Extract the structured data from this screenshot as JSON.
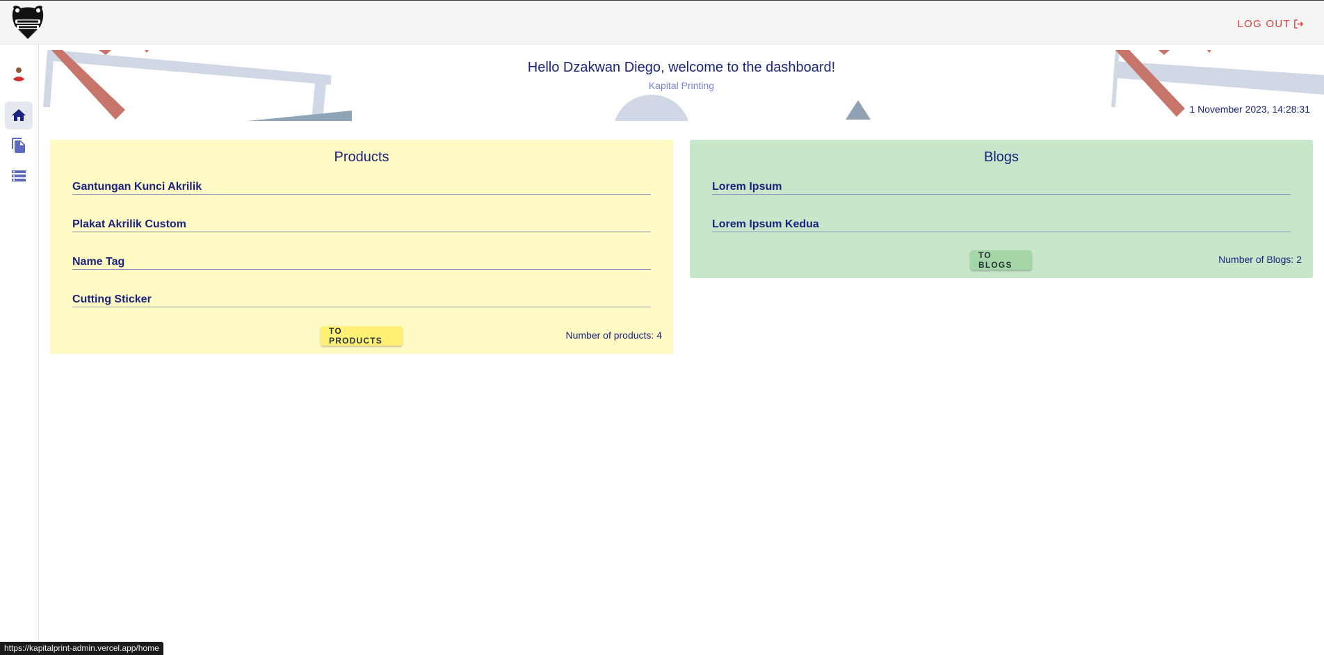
{
  "header": {
    "logout_label": "LOG OUT"
  },
  "hero": {
    "greeting": "Hello Dzakwan Diego, welcome to the dashboard!",
    "subtitle": "Kapital Printing",
    "datetime": "1 November 2023, 14:28:31"
  },
  "products": {
    "title": "Products",
    "items": [
      "Gantungan Kunci Akrilik",
      "Plakat Akrilik Custom",
      "Name Tag",
      "Cutting Sticker"
    ],
    "button_label": "TO PRODUCTS",
    "count_label": "Number of products: 4"
  },
  "blogs": {
    "title": "Blogs",
    "items": [
      "Lorem Ipsum",
      "Lorem Ipsum Kedua"
    ],
    "button_label": "TO BLOGS",
    "count_label": "Number of Blogs: 2"
  },
  "status_bar": {
    "url": "https://kapitalprint-admin.vercel.app/home"
  },
  "colors": {
    "primary_text": "#1a237e",
    "logout": "#e53935",
    "products_card": "#fff9c4",
    "blogs_card": "#c8e6c9"
  },
  "icons": {
    "sidebar": [
      "home-icon",
      "document-icon",
      "storage-icon"
    ],
    "logout": "logout-icon"
  }
}
